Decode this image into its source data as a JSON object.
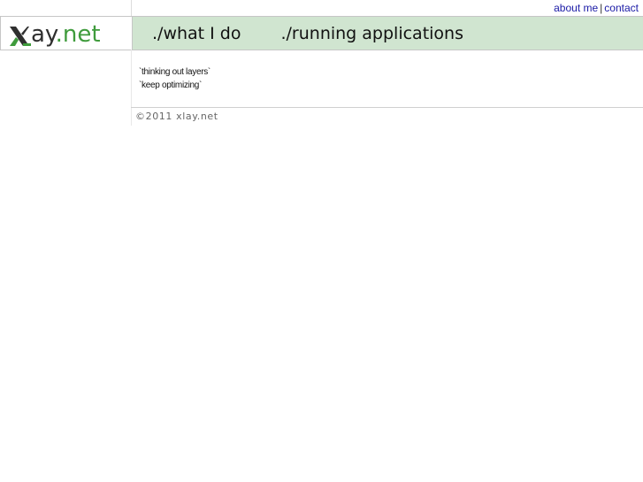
{
  "top_links": {
    "about": "about me",
    "separator": "|",
    "contact": "contact"
  },
  "logo": {
    "mark": "X",
    "ay": "ay",
    "net": ".net"
  },
  "nav": {
    "items": [
      {
        "label": "./what I do"
      },
      {
        "label": "./running applications"
      }
    ]
  },
  "taglines": [
    "`thinking out layers`",
    "`keep optimizing`"
  ],
  "footer": {
    "copyright": "©2011 xlay.net"
  },
  "colors": {
    "header_bg": "#d0e5d0",
    "link": "#1a1aa6",
    "logo_green": "#3f9b3c"
  }
}
